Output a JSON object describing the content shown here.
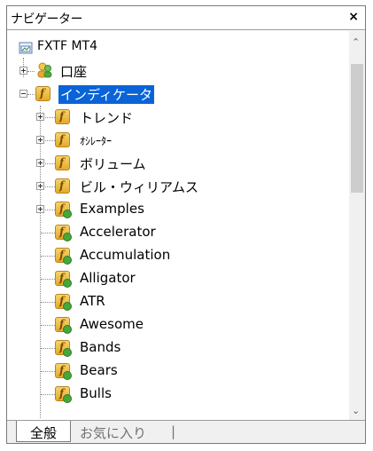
{
  "window": {
    "title": "ナビゲーター",
    "close_glyph": "×"
  },
  "tree": {
    "root": "FXTF MT4",
    "accounts": "口座",
    "indicators": "インディケータ",
    "folders": [
      "トレンド",
      "ｵｼﾚｰﾀｰ",
      "ボリューム",
      "ビル・ウィリアムス",
      "Examples"
    ],
    "items": [
      "Accelerator",
      "Accumulation",
      "Alligator",
      "ATR",
      "Awesome",
      "Bands",
      "Bears",
      "Bulls"
    ]
  },
  "tabs": {
    "active": "全般",
    "inactive": "お気に入り",
    "separator": "|"
  },
  "icons": {
    "root": "terminal-icon",
    "accounts": "accounts-icon",
    "folder": "indicator-folder-icon",
    "item": "custom-indicator-icon"
  },
  "colors": {
    "selection": "#0a64d8",
    "icon_gold": "#e6a92a"
  }
}
